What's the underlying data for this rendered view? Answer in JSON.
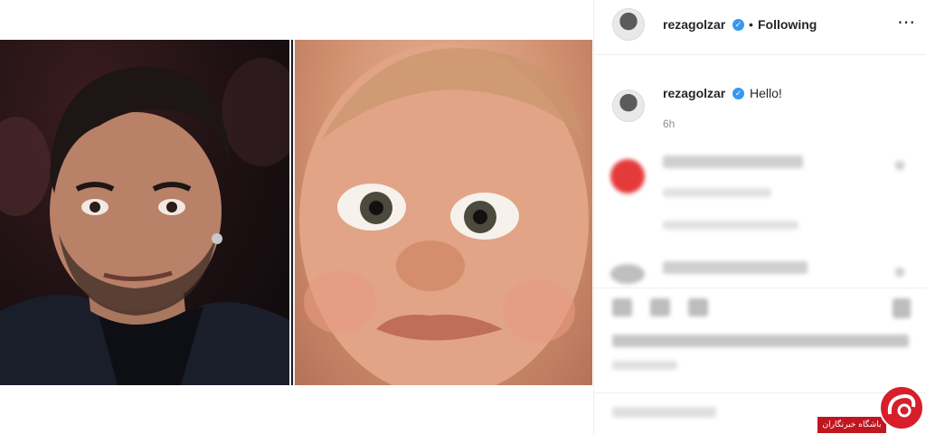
{
  "post": {
    "username": "rezagolzar",
    "separator": "•",
    "follow_state": "Following",
    "more_icon": "more-horizontal-icon",
    "verified_icon": "verified-badge-icon",
    "caption_username": "rezagolzar",
    "caption_text": "Hello!",
    "caption_time": "6h"
  },
  "colors": {
    "verified": "#3897f0",
    "text": "#262626",
    "muted": "#8e8e8e",
    "watermark": "#d81e2a"
  },
  "watermark": {
    "text": "باشگاه خبرنگاران"
  }
}
